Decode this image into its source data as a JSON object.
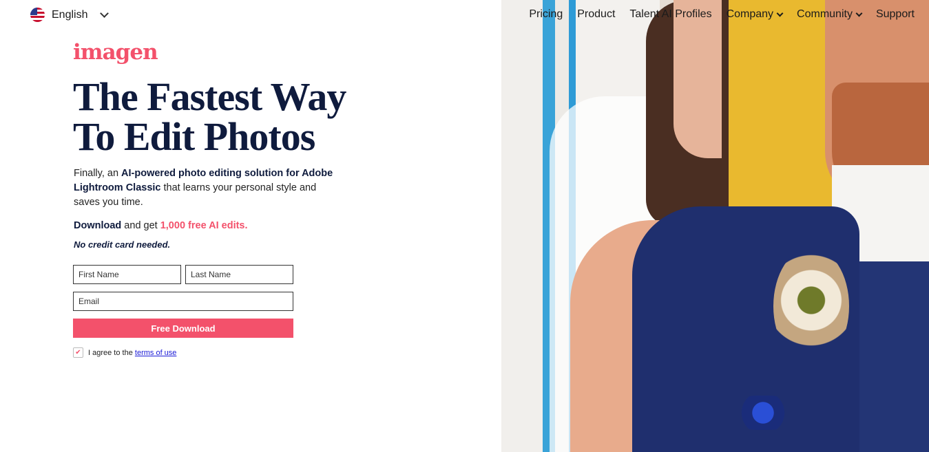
{
  "language": {
    "label": "English",
    "flag_icon": "us-flag-icon"
  },
  "nav": {
    "items": [
      {
        "label": "Pricing",
        "has_dropdown": false
      },
      {
        "label": "Product",
        "has_dropdown": false
      },
      {
        "label": "Talent AI Profiles",
        "has_dropdown": false
      },
      {
        "label": "Company",
        "has_dropdown": true
      },
      {
        "label": "Community",
        "has_dropdown": true
      },
      {
        "label": "Support",
        "has_dropdown": false
      }
    ]
  },
  "brand": {
    "logo_text": "imagen",
    "color": "#f3516b"
  },
  "hero": {
    "headline_line1": "The Fastest Way",
    "headline_line2": "To Edit Photos",
    "desc_pre": "Finally, an ",
    "desc_bold": "AI-powered photo editing solution for Adobe Lightroom Classic",
    "desc_post": " that learns your personal style and saves you time.",
    "offer_bold": "Download",
    "offer_mid": " and get ",
    "offer_highlight": "1,000 free AI edits.",
    "no_card": "No credit card needed."
  },
  "form": {
    "first_name_placeholder": "First Name",
    "last_name_placeholder": "Last Name",
    "email_placeholder": "Email",
    "submit_label": "Free Download",
    "agree_text": "I agree to the ",
    "terms_link": "terms of use",
    "agree_checked": true
  },
  "colors": {
    "accent": "#f3516b",
    "heading": "#0f1b3d",
    "link": "#1a1ad6"
  }
}
